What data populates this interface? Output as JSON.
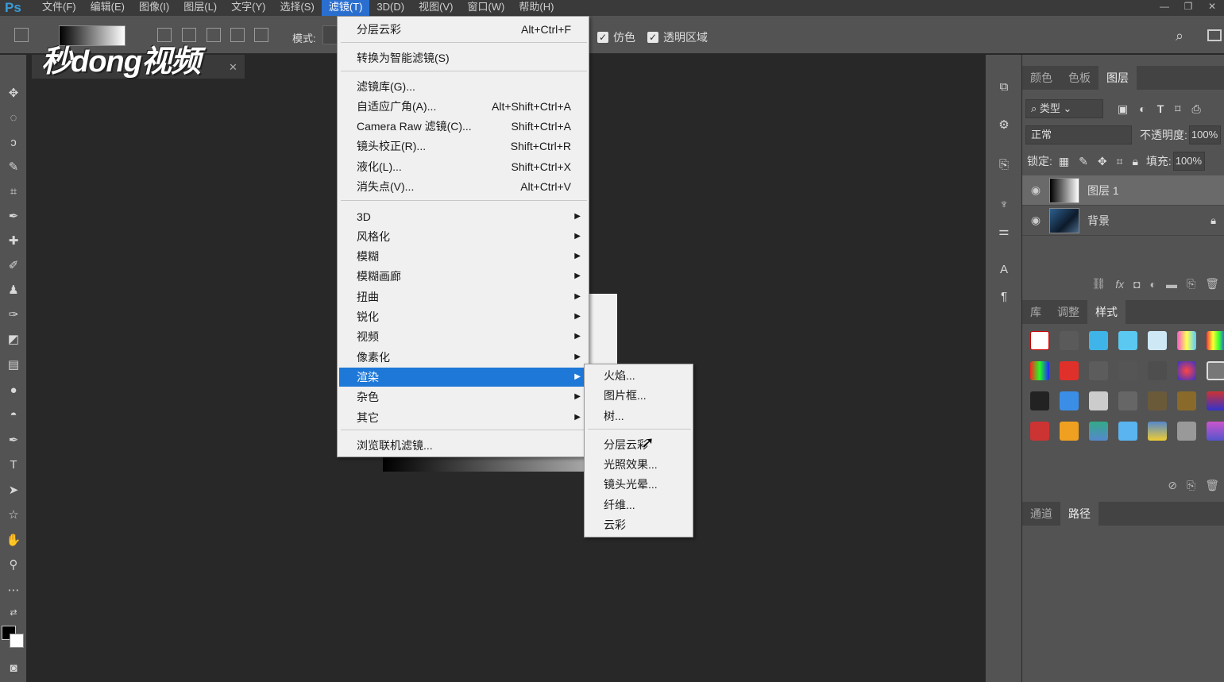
{
  "app": {
    "logo": "Ps",
    "watermark": "秒dong视频"
  },
  "menubar": {
    "items": [
      "文件(F)",
      "编辑(E)",
      "图像(I)",
      "图层(L)",
      "文字(Y)",
      "选择(S)",
      "滤镜(T)",
      "3D(D)",
      "视图(V)",
      "窗口(W)",
      "帮助(H)"
    ],
    "active_index": 6
  },
  "optionsbar": {
    "mode_label": "模式:",
    "dither_label": "仿色",
    "transparency_label": "透明区域",
    "dither_checked": true,
    "transparency_checked": true
  },
  "filter_menu": {
    "last_filter": {
      "label": "分层云彩",
      "shortcut": "Alt+Ctrl+F"
    },
    "smart_filters": "转换为智能滤镜(S)",
    "items_a": [
      {
        "label": "滤镜库(G)...",
        "shortcut": ""
      },
      {
        "label": "自适应广角(A)...",
        "shortcut": "Alt+Shift+Ctrl+A"
      },
      {
        "label": "Camera Raw 滤镜(C)...",
        "shortcut": "Shift+Ctrl+A"
      },
      {
        "label": "镜头校正(R)...",
        "shortcut": "Shift+Ctrl+R"
      },
      {
        "label": "液化(L)...",
        "shortcut": "Shift+Ctrl+X"
      },
      {
        "label": "消失点(V)...",
        "shortcut": "Alt+Ctrl+V"
      }
    ],
    "submenus": [
      "3D",
      "风格化",
      "模糊",
      "模糊画廊",
      "扭曲",
      "锐化",
      "视频",
      "像素化",
      "渲染",
      "杂色",
      "其它"
    ],
    "highlighted_submenu": "渲染",
    "browse_online": "浏览联机滤镜..."
  },
  "render_submenu": {
    "group_a": [
      "火焰...",
      "图片框...",
      "树..."
    ],
    "group_b": [
      "分层云彩",
      "光照效果...",
      "镜头光晕...",
      "纤维...",
      "云彩"
    ]
  },
  "layers_panel": {
    "tabs": [
      "颜色",
      "色板",
      "图层"
    ],
    "active_tab": "图层",
    "filter_kind": "类型",
    "blend_mode": "正常",
    "opacity_label": "不透明度:",
    "opacity_value": "100%",
    "lock_label": "锁定:",
    "fill_label": "填充:",
    "fill_value": "100%",
    "layers": [
      {
        "name": "图层 1",
        "selected": true,
        "locked": false
      },
      {
        "name": "背景",
        "selected": false,
        "locked": true
      }
    ]
  },
  "styles_panel": {
    "tabs": [
      "库",
      "调整",
      "样式"
    ],
    "active_tab": "样式"
  },
  "paths_panel": {
    "tabs": [
      "通道",
      "路径"
    ],
    "active_tab": "路径"
  },
  "colors": {
    "accent": "#1e78d8",
    "menu_bg": "#f0f0f0",
    "ui_dark": "#535353",
    "canvas_bg": "#282828"
  }
}
